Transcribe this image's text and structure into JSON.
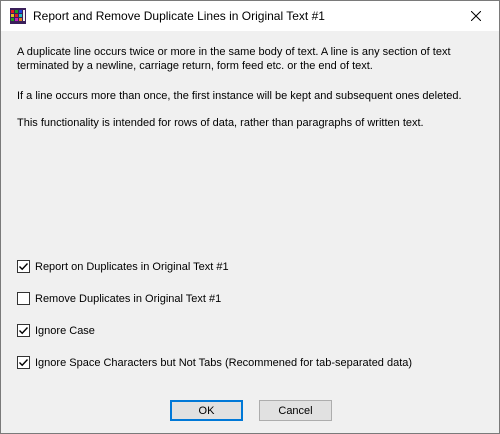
{
  "window": {
    "title": "Report and Remove Duplicate Lines in Original Text #1"
  },
  "description": {
    "p1": "A duplicate line occurs twice or more in the same body of text. A line is any section of text terminated by a newline, carriage return, form feed etc. or the end of text.",
    "p2": "If a line occurs more than once, the first instance will be kept and subsequent ones deleted.",
    "p3": "This functionality is intended for rows of data, rather than paragraphs of written text."
  },
  "options": [
    {
      "label": "Report on Duplicates in Original Text #1",
      "checked": true
    },
    {
      "label": "Remove Duplicates in Original Text #1",
      "checked": false
    },
    {
      "label": "Ignore Case",
      "checked": true
    },
    {
      "label": "Ignore Space Characters but Not Tabs (Recommened for tab-separated data)",
      "checked": true
    }
  ],
  "buttons": {
    "ok": "OK",
    "cancel": "Cancel"
  }
}
